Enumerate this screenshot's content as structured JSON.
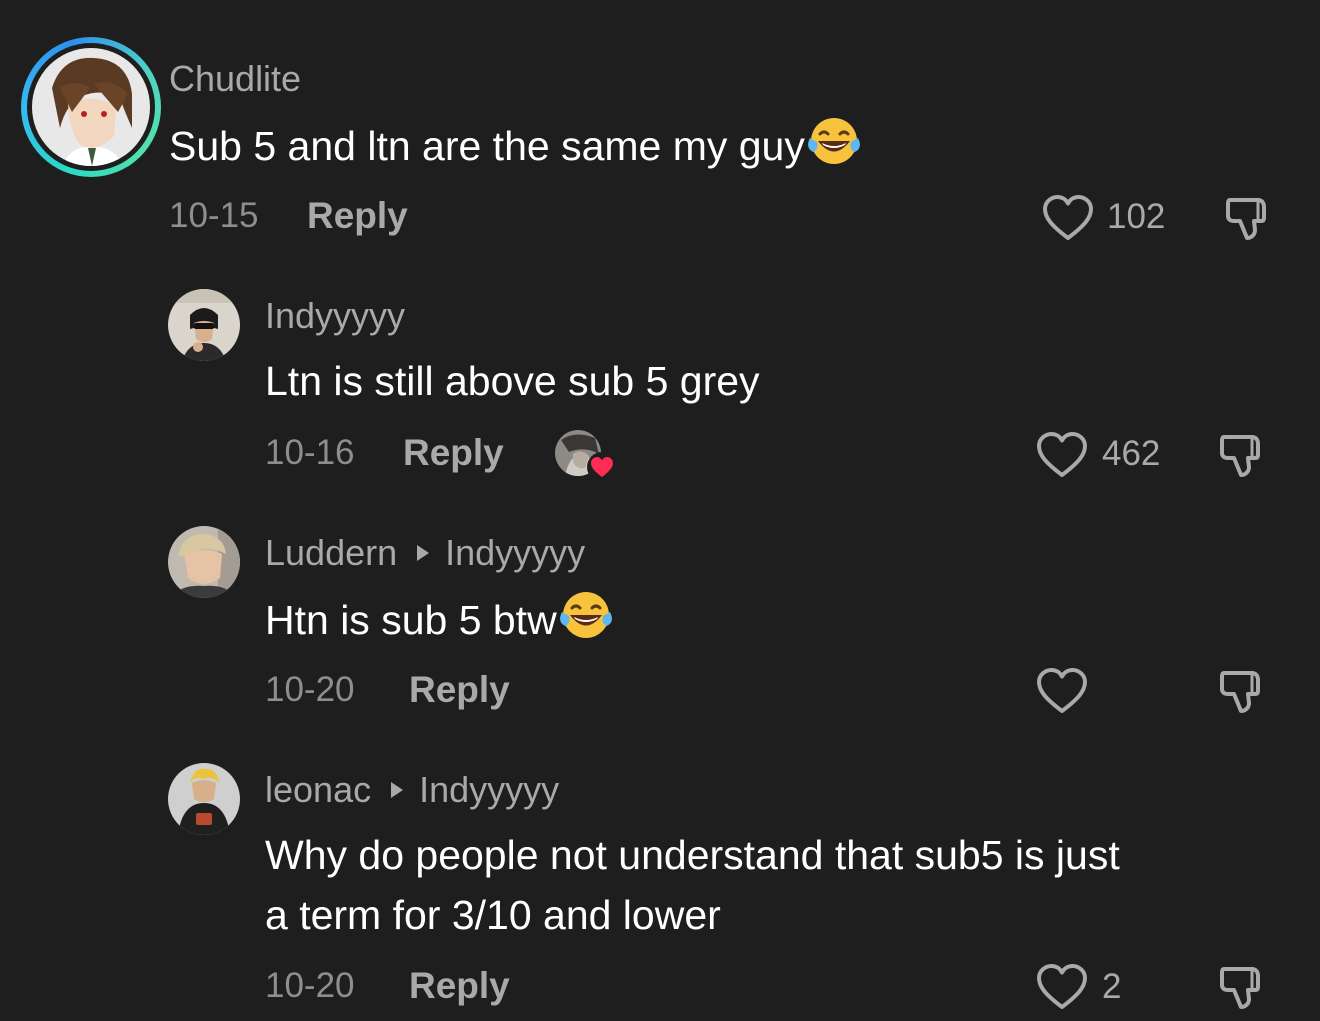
{
  "comments": [
    {
      "username": "Chudlite",
      "text": "Sub 5 and ltn are the same my guy",
      "emoji": "face-with-tears-of-joy",
      "date": "10-15",
      "reply_label": "Reply",
      "likes": "102"
    },
    {
      "username": "Indyyyyy",
      "text": "Ltn is still above sub 5 grey",
      "date": "10-16",
      "reply_label": "Reply",
      "likes": "462",
      "liked_by_creator": true
    },
    {
      "username": "Luddern",
      "reply_to": "Indyyyyy",
      "text": "Htn is sub 5 btw",
      "emoji": "face-with-tears-of-joy",
      "date": "10-20",
      "reply_label": "Reply",
      "likes": ""
    },
    {
      "username": "leonac",
      "reply_to": "Indyyyyy",
      "text_line1": "Why do people not understand that sub5 is just",
      "text_line2": "a term for 3/10 and lower",
      "date": "10-20",
      "reply_label": "Reply",
      "likes": "2"
    }
  ],
  "colors": {
    "background": "#1e1e1e",
    "username": "#a9a9a9",
    "text": "#ffffff",
    "meta": "#8e8e8e",
    "heart_badge": "#fe2c55",
    "story_ring": "#37b8f0"
  }
}
